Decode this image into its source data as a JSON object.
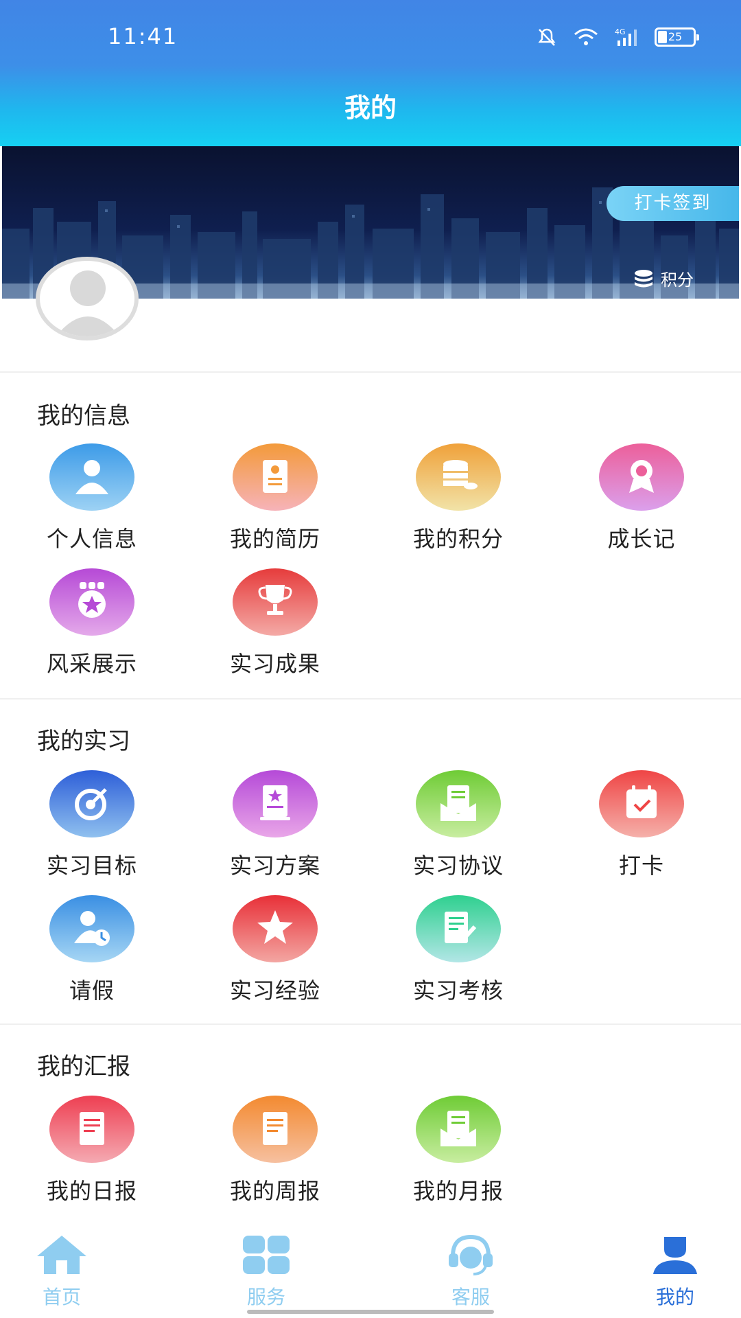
{
  "status_bar": {
    "time": "11:41",
    "battery": "25"
  },
  "header": {
    "title": "我的"
  },
  "banner": {
    "checkin_label": "打卡签到",
    "points_label": "积分"
  },
  "sections": [
    {
      "title": "我的信息",
      "items": [
        {
          "label": "个人信息",
          "icon": "person-icon",
          "color": "#3d9be8"
        },
        {
          "label": "我的简历",
          "icon": "resume-icon",
          "color": "#f39a3a"
        },
        {
          "label": "我的积分",
          "icon": "coins-icon",
          "color": "#f0b14a"
        },
        {
          "label": "成长记",
          "icon": "medal-icon",
          "color": "#ec5f9a"
        },
        {
          "label": "风采展示",
          "icon": "badge-star-icon",
          "color": "#b64ad6"
        },
        {
          "label": "实习成果",
          "icon": "trophy-icon",
          "color": "#e94545"
        }
      ]
    },
    {
      "title": "我的实习",
      "items": [
        {
          "label": "实习目标",
          "icon": "target-icon",
          "color": "#3d6fe0"
        },
        {
          "label": "实习方案",
          "icon": "plan-book-icon",
          "color": "#b54ad8"
        },
        {
          "label": "实习协议",
          "icon": "agreement-icon",
          "color": "#79d13d"
        },
        {
          "label": "打卡",
          "icon": "calendar-check-icon",
          "color": "#ef5656"
        },
        {
          "label": "请假",
          "icon": "leave-clock-icon",
          "color": "#3a9ae6"
        },
        {
          "label": "实习经验",
          "icon": "star-icon",
          "color": "#e83d44"
        },
        {
          "label": "实习考核",
          "icon": "assessment-icon",
          "color": "#35d2a0"
        }
      ]
    },
    {
      "title": "我的汇报",
      "items": [
        {
          "label": "我的日报",
          "icon": "daily-report-icon",
          "color": "#ef4a5a"
        },
        {
          "label": "我的周报",
          "icon": "weekly-report-icon",
          "color": "#f3963a"
        },
        {
          "label": "我的月报",
          "icon": "monthly-report-icon",
          "color": "#79d13d"
        }
      ]
    }
  ],
  "bottom_nav": [
    {
      "label": "首页",
      "icon": "home-icon",
      "active": false
    },
    {
      "label": "服务",
      "icon": "grid-icon",
      "active": false
    },
    {
      "label": "客服",
      "icon": "headset-icon",
      "active": false
    },
    {
      "label": "我的",
      "icon": "profile-icon",
      "active": true
    }
  ],
  "colors": {
    "nav_inactive": "#8fcdf0",
    "nav_active": "#2a6fd8",
    "accent": "#16d0f2"
  }
}
